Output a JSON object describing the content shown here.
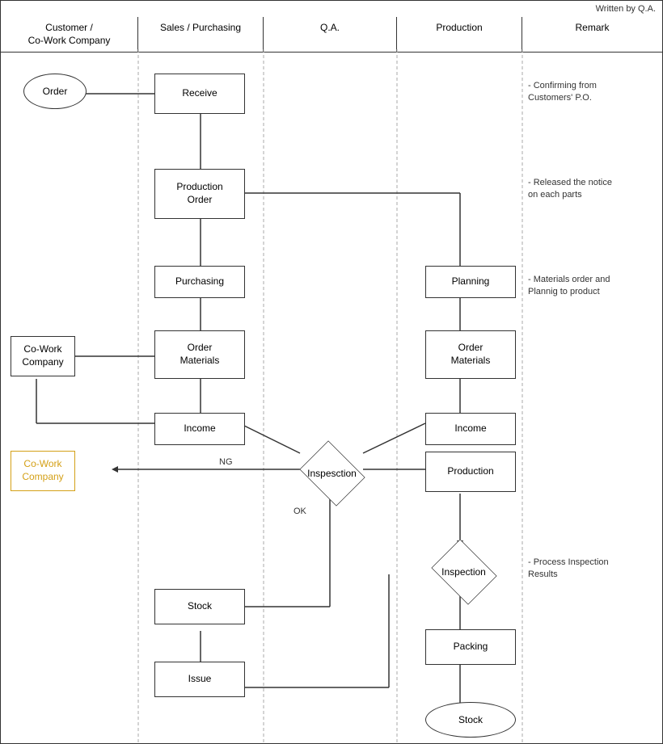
{
  "written_by": "Written by Q.A.",
  "header": {
    "columns": [
      {
        "id": "customer",
        "label": "Customer /\nCo-Work Company"
      },
      {
        "id": "sales",
        "label": "Sales / Purchasing"
      },
      {
        "id": "qa",
        "label": "Q.A."
      },
      {
        "id": "production",
        "label": "Production"
      },
      {
        "id": "remark",
        "label": "Remark"
      }
    ]
  },
  "nodes": {
    "order": "Order",
    "receive": "Receive",
    "production_order": "Production\nOrder",
    "purchasing": "Purchasing",
    "cowork_company_left": "Co-Work\nCompany",
    "order_materials_sales": "Order\nMaterials",
    "income_sales": "Income",
    "planning": "Planning",
    "order_materials_prod": "Order\nMaterials",
    "income_prod": "Income",
    "inspection_diamond": "Inspesction",
    "production": "Production",
    "cowork_company_colored": "Co-Work\nCompany",
    "inspection_prod": "Inspection",
    "stock_sales": "Stock",
    "issue": "Issue",
    "packing": "Packing",
    "stock_prod": "Stock"
  },
  "labels": {
    "ng": "NG",
    "ok": "OK"
  },
  "remarks": {
    "r1": "- Confirming from\n  Customers' P.O.",
    "r2": "- Released the notice\n  on each parts",
    "r3": "- Materials order and\n  Plannig to product",
    "r4": "- Process Inspection\n  Results"
  },
  "colors": {
    "border": "#333333",
    "dashed": "#aaaaaa",
    "cowork_gold": "#c8960c",
    "arrow": "#333333"
  }
}
